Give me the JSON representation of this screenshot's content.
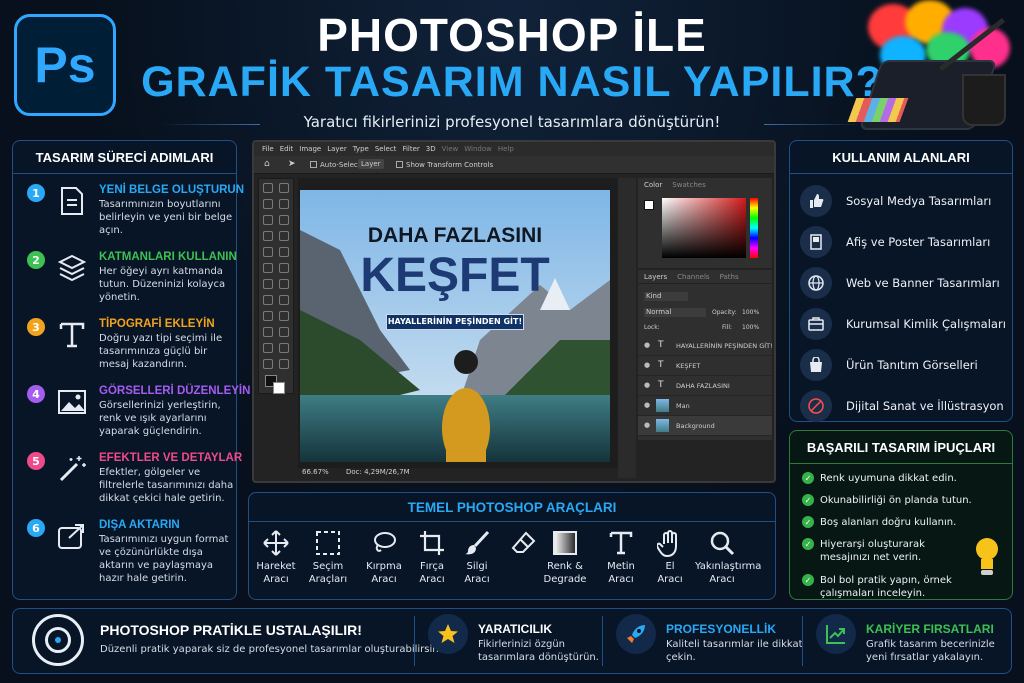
{
  "header": {
    "logo": "Ps",
    "title_line1": "PHOTOSHOP İLE",
    "title_line2": "GRAFİK TASARIM NASIL YAPILIR?",
    "subtitle": "Yaratıcı fikirlerinizi profesyonel tasarımlara dönüştürün!"
  },
  "colors": {
    "accent": "#29a9f5",
    "ps_blue": "#31a8ff",
    "green": "#36b24a",
    "panel_border": "#1f4f86"
  },
  "steps_panel": {
    "title": "TASARIM SÜRECİ ADIMLARI",
    "steps": [
      {
        "num": "1",
        "title": "YENİ BELGE OLUŞTURUN",
        "desc": "Tasarımınızın boyutlarını belirleyin ve yeni bir belge açın.",
        "color": "#29a9f5",
        "icon": "document-icon"
      },
      {
        "num": "2",
        "title": "KATMANLARI KULLANIN",
        "desc": "Her öğeyi ayrı katmanda tutun. Düzeninizi kolayca yönetin.",
        "color": "#3cc152",
        "icon": "layers-icon"
      },
      {
        "num": "3",
        "title": "TİPOGRAFİ EKLEYİN",
        "desc": "Doğru yazı tipi seçimi ile tasarımınıza güçlü bir mesaj kazandırın.",
        "color": "#f2a31b",
        "icon": "type-icon"
      },
      {
        "num": "4",
        "title": "GÖRSELLERİ DÜZENLEYİN",
        "desc": "Görsellerinizi yerleştirin, renk ve ışık ayarlarını yaparak güçlendirin.",
        "color": "#a55cf0",
        "icon": "image-icon"
      },
      {
        "num": "5",
        "title": "EFEKTLER VE DETAYLAR",
        "desc": "Efektler, gölgeler ve filtrelerle tasarımınızı daha dikkat çekici hale getirin.",
        "color": "#ef4a8a",
        "icon": "magic-wand-icon"
      },
      {
        "num": "6",
        "title": "DIŞA AKTARIN",
        "desc": "Tasarımınızı uygun format ve çözünürlükte dışa aktarın ve paylaşmaya hazır hale getirin.",
        "color": "#29a9f5",
        "icon": "export-icon"
      }
    ]
  },
  "photoshop_window": {
    "menu": [
      "File",
      "Edit",
      "Image",
      "Layer",
      "Type",
      "Select",
      "Filter",
      "3D",
      "View",
      "Window",
      "Help"
    ],
    "options": {
      "auto_select": "Auto-Select",
      "layer": "Layer",
      "transform": "Show Transform Controls"
    },
    "canvas": {
      "headline1": "DAHA FAZLASINI",
      "headline2": "KEŞFET",
      "tagline": "HAYALLERİNİN PEŞİNDEN GİT!"
    },
    "status": {
      "zoom": "66.67%",
      "doc": "Doc: 4,29M/26,7M"
    },
    "color_tabs": [
      "Color",
      "Swatches"
    ],
    "layer_tabs": [
      "Layers",
      "Channels",
      "Paths"
    ],
    "layer_opts": {
      "kind": "Kind",
      "mode": "Normal",
      "opacity": "Opacity:",
      "opacity_val": "100%",
      "lock": "Lock:",
      "fill": "Fill:",
      "fill_val": "100%"
    },
    "layers": [
      {
        "type": "T",
        "name": "HAYALLERİNİN PEŞİNDEN GİT!"
      },
      {
        "type": "T",
        "name": "KEŞFET"
      },
      {
        "type": "T",
        "name": "DAHA FAZLASINI"
      },
      {
        "type": "img",
        "name": "Man"
      },
      {
        "type": "img",
        "name": "Background"
      }
    ]
  },
  "tools_panel": {
    "title": "TEMEL PHOTOSHOP ARAÇLARI",
    "tools": [
      {
        "line1": "Hareket",
        "line2": "Aracı",
        "icon": "move-icon"
      },
      {
        "line1": "Seçim",
        "line2": "Araçları",
        "icon": "marquee-icon"
      },
      {
        "line1": "Kırpma",
        "line2": "Aracı",
        "icon": "lasso-icon"
      },
      {
        "line1": "Fırça",
        "line2": "Aracı",
        "icon": "crop-icon"
      },
      {
        "line1": "Silgi",
        "line2": "Aracı",
        "icon": "brush-icon"
      },
      {
        "line1": "",
        "line2": "",
        "icon": "eraser-icon"
      },
      {
        "line1": "Renk &",
        "line2": "Degrade",
        "icon": "gradient-icon"
      },
      {
        "line1": "Metin",
        "line2": "Aracı",
        "icon": "text-tool-icon"
      },
      {
        "line1": "El",
        "line2": "Aracı",
        "icon": "hand-icon"
      },
      {
        "line1": "Yakınlaştırma",
        "line2": "Aracı",
        "icon": "zoom-icon"
      }
    ]
  },
  "usage_panel": {
    "title": "KULLANIM ALANLARI",
    "items": [
      {
        "label": "Sosyal Medya Tasarımları",
        "icon": "thumbs-up-icon"
      },
      {
        "label": "Afiş ve Poster Tasarımları",
        "icon": "poster-icon"
      },
      {
        "label": "Web ve Banner Tasarımları",
        "icon": "globe-icon"
      },
      {
        "label": "Kurumsal Kimlik Çalışmaları",
        "icon": "briefcase-icon"
      },
      {
        "label": "Ürün Tanıtım Görselleri",
        "icon": "shopping-bag-icon"
      },
      {
        "label": "Dijital Sanat ve İllüstrasyon",
        "icon": "pen-nib-icon"
      }
    ]
  },
  "tips_panel": {
    "title": "BAŞARILI TASARIM İPUÇLARI",
    "tips": [
      "Renk uyumuna dikkat edin.",
      "Okunabilirliği ön planda tutun.",
      "Boş alanları doğru kullanın.",
      "Hiyerarşi oluşturarak mesajınızı net verin.",
      "Bol bol pratik yapın, örnek çalışmaları inceleyin."
    ]
  },
  "bottom": {
    "main_title": "PHOTOSHOP PRATİKLE USTALAŞILIR!",
    "main_desc": "Düzenli pratik yaparak siz de profesyonel tasarımlar oluşturabilirsiniz.",
    "sections": [
      {
        "title": "YARATICILIK",
        "desc": "Fikirlerinizi özgün tasarımlara dönüştürün.",
        "color": "#ffffff",
        "icon": "star-icon"
      },
      {
        "title": "PROFESYONELLİK",
        "desc": "Kaliteli tasarımlar ile dikkat çekin.",
        "color": "#29a9f5",
        "icon": "rocket-icon"
      },
      {
        "title": "KARİYER FIRSATLARI",
        "desc": "Grafik tasarım becerinizle yeni fırsatlar yakalayın.",
        "color": "#3cc152",
        "icon": "chart-up-icon"
      }
    ]
  }
}
